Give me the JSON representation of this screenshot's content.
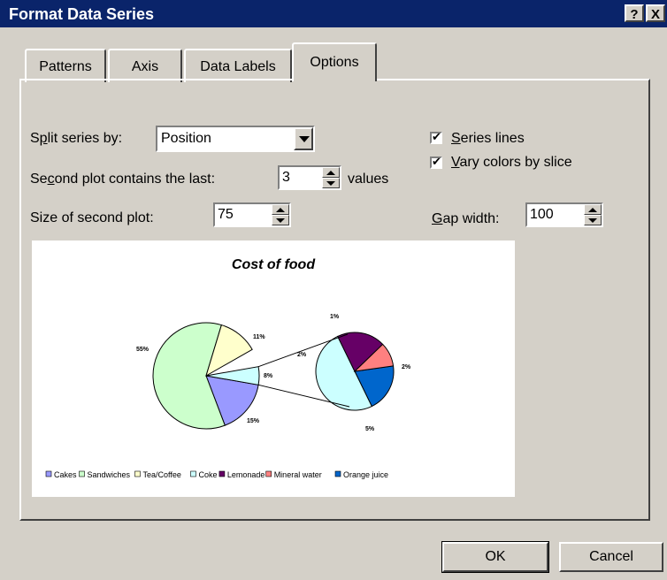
{
  "dialog": {
    "title": "Format Data Series",
    "help_label": "?",
    "close_label": "X"
  },
  "tabs": [
    {
      "label": "Patterns"
    },
    {
      "label": "Axis"
    },
    {
      "label": "Data Labels"
    },
    {
      "label": "Options",
      "active": true
    }
  ],
  "options": {
    "split_label": "Split series by:",
    "split_value": "Position",
    "second_plot_label": "Second plot contains the last:",
    "second_plot_value": "3",
    "values_label": "values",
    "size_label": "Size of second plot:",
    "size_value": "75",
    "series_lines_label": "Series lines",
    "series_lines_checked": true,
    "vary_colors_label": "Vary colors by slice",
    "vary_colors_checked": true,
    "gap_label": "Gap width:",
    "gap_value": "100"
  },
  "buttons": {
    "ok": "OK",
    "cancel": "Cancel"
  },
  "chart_data": {
    "type": "pie",
    "title": "Cost of food",
    "categories": [
      "Cakes",
      "Sandwiches",
      "Tea/Coffee",
      "Coke",
      "Lemonade",
      "Mineral water",
      "Orange juice"
    ],
    "values": [
      15,
      55,
      11,
      5,
      2,
      1,
      2
    ],
    "colors": [
      "#9999ff",
      "#ccffcc",
      "#ffffcc",
      "#ccffff",
      "#660066",
      "#ff8080",
      "#0066cc"
    ],
    "data_labels": [
      "15%",
      "55%",
      "11%",
      "5%",
      "2%",
      "1%",
      "2%"
    ],
    "secondary_plot_count": 3,
    "secondary_label": "8%",
    "legend_labels": [
      "Cakes",
      "Sandwiches",
      "Tea/Coffee",
      "Coke",
      "Lemonade",
      "Mineral water",
      "Orange juice"
    ],
    "legend_position": "bottom"
  }
}
